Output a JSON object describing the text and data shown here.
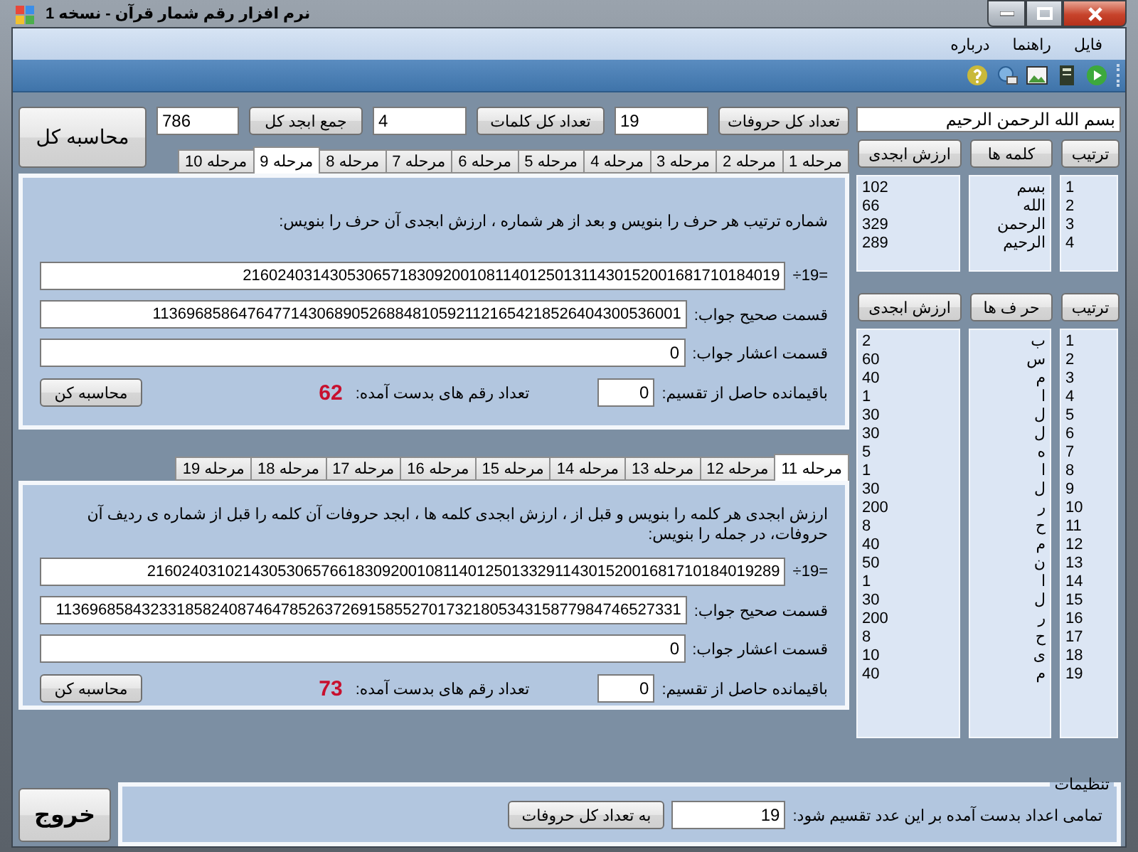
{
  "window": {
    "title": "نرم افزار رقم شمار قرآن - نسخه 1"
  },
  "menu": [
    {
      "label": "فایل"
    },
    {
      "label": "راهنما"
    },
    {
      "label": "درباره"
    }
  ],
  "summary": {
    "sentence": "بسم الله الرحمن الرحیم",
    "letters_button": "تعداد کل حروفات",
    "letters_value": "19",
    "words_button": "تعداد کل کلمات",
    "words_value": "4",
    "abjad_button": "جمع ابجد کل",
    "abjad_value": "786",
    "calc_all_button": "محاسبه کل"
  },
  "stages_top": {
    "tabs": [
      {
        "label": "مرحله 1",
        "selected": false
      },
      {
        "label": "مرحله 2",
        "selected": false
      },
      {
        "label": "مرحله 3",
        "selected": false
      },
      {
        "label": "مرحله 4",
        "selected": false
      },
      {
        "label": "مرحله 5",
        "selected": false
      },
      {
        "label": "مرحله 6",
        "selected": false
      },
      {
        "label": "مرحله 7",
        "selected": false
      },
      {
        "label": "مرحله 8",
        "selected": false
      },
      {
        "label": "مرحله 9",
        "selected": true
      },
      {
        "label": "مرحله 10",
        "selected": false
      }
    ],
    "panel": {
      "instruction": "شماره ترتیب هر حرف را بنویس و بعد از هر شماره ، ارزش ابجدی آن حرف را بنویس:",
      "divisor_label": "÷19=",
      "dividend": "21602403143053065718309200108114012501311430152001681710184019",
      "quotient_label": "قسمت صحیح جواب:",
      "quotient": "1136968586476477143068905268848105921121654218526404300536001",
      "decimal_label": "قسمت اعشار جواب:",
      "decimal": "0",
      "remainder_label": "باقیمانده حاصل از تقسیم:",
      "remainder": "0",
      "digits_label": "تعداد رقم های بدست آمده:",
      "digits_count": "62",
      "button": "محاسبه کن"
    }
  },
  "stages_bottom": {
    "tabs": [
      {
        "label": "مرحله 11",
        "selected": true
      },
      {
        "label": "مرحله 12",
        "selected": false
      },
      {
        "label": "مرحله 13",
        "selected": false
      },
      {
        "label": "مرحله 14",
        "selected": false
      },
      {
        "label": "مرحله 15",
        "selected": false
      },
      {
        "label": "مرحله 16",
        "selected": false
      },
      {
        "label": "مرحله 17",
        "selected": false
      },
      {
        "label": "مرحله 18",
        "selected": false
      },
      {
        "label": "مرحله 19",
        "selected": false
      }
    ],
    "panel": {
      "instruction": "ارزش ابجدی هر کلمه را بنویس و قبل از ، ارزش ابجدی کلمه ها ، ابجد حروفات آن کلمه را قبل از شماره ی ردیف آن حروفات، در جمله را بنویس:",
      "divisor_label": "÷19=",
      "dividend": "2160240310214305306576618309200108114012501332911430152001681710184019289",
      "quotient_label": "قسمت صحیح جواب:",
      "quotient": "113696858432331858240874647852637269158552701732180534315877984746527331",
      "decimal_label": "قسمت اعشار جواب:",
      "decimal": "0",
      "remainder_label": "باقیمانده حاصل از تقسیم:",
      "remainder": "0",
      "digits_label": "تعداد رقم های بدست آمده:",
      "digits_count": "73",
      "button": "محاسبه کن"
    }
  },
  "words_table": {
    "columns": [
      "ترتیب",
      "کلمه ها",
      "ارزش ابجدی"
    ],
    "rows": [
      {
        "order": "1",
        "text": "بسم",
        "value": "102"
      },
      {
        "order": "2",
        "text": "الله",
        "value": "66"
      },
      {
        "order": "3",
        "text": "الرحمن",
        "value": "329"
      },
      {
        "order": "4",
        "text": "الرحیم",
        "value": "289"
      }
    ]
  },
  "letters_table": {
    "columns": [
      "ترتیب",
      "حر ف ها",
      "ارزش ابجدی"
    ],
    "rows": [
      {
        "order": "1",
        "text": "ب",
        "value": "2"
      },
      {
        "order": "2",
        "text": "س",
        "value": "60"
      },
      {
        "order": "3",
        "text": "م",
        "value": "40"
      },
      {
        "order": "4",
        "text": "ا",
        "value": "1"
      },
      {
        "order": "5",
        "text": "ل",
        "value": "30"
      },
      {
        "order": "6",
        "text": "ل",
        "value": "30"
      },
      {
        "order": "7",
        "text": "ه",
        "value": "5"
      },
      {
        "order": "8",
        "text": "ا",
        "value": "1"
      },
      {
        "order": "9",
        "text": "ل",
        "value": "30"
      },
      {
        "order": "10",
        "text": "ر",
        "value": "200"
      },
      {
        "order": "11",
        "text": "ح",
        "value": "8"
      },
      {
        "order": "12",
        "text": "م",
        "value": "40"
      },
      {
        "order": "13",
        "text": "ن",
        "value": "50"
      },
      {
        "order": "14",
        "text": "ا",
        "value": "1"
      },
      {
        "order": "15",
        "text": "ل",
        "value": "30"
      },
      {
        "order": "16",
        "text": "ر",
        "value": "200"
      },
      {
        "order": "17",
        "text": "ح",
        "value": "8"
      },
      {
        "order": "18",
        "text": "ی",
        "value": "10"
      },
      {
        "order": "19",
        "text": "م",
        "value": "40"
      }
    ]
  },
  "exit_button": "خروج",
  "settings": {
    "title": "تنظیمات",
    "label": "تمامی اعداد بدست آمده بر این عدد تقسیم شود:",
    "value": "19",
    "button": "به تعداد کل حروفات"
  }
}
